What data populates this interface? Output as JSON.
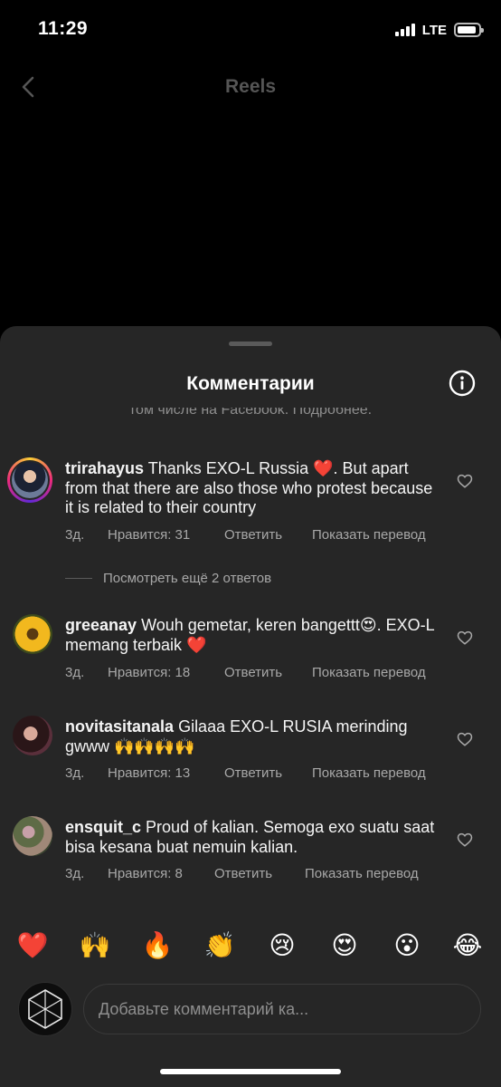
{
  "status_bar": {
    "time": "11:29",
    "network": "LTE"
  },
  "nav": {
    "title": "Reels"
  },
  "sheet": {
    "title": "Комментарии",
    "clipped_notice": "том числе на Facebook. Подробнее."
  },
  "comments": [
    {
      "username": "trirahayus",
      "text": "Thanks EXO-L Russia ❤️. But apart from that there are also those who protest because it is related to their country",
      "time": "3д.",
      "likes": "Нравится: 31",
      "reply": "Ответить",
      "translate": "Показать перевод"
    },
    {
      "username": "greeanay",
      "text": "Wouh gemetar, keren bangettt😍. EXO-L memang terbaik ❤️",
      "time": "3д.",
      "likes": "Нравится: 18",
      "reply": "Ответить",
      "translate": "Показать перевод"
    },
    {
      "username": "novitasitanala",
      "text": "Gilaaa EXO-L RUSIA merinding gwww 🙌🙌🙌🙌",
      "time": "3д.",
      "likes": "Нравится: 13",
      "reply": "Ответить",
      "translate": "Показать перевод"
    },
    {
      "username": "ensquit_c",
      "text": "Proud of kalian. Semoga exo suatu saat bisa kesana buat nemuin kalian.",
      "time": "3д.",
      "likes": "Нравится: 8",
      "reply": "Ответить",
      "translate": "Показать перевод"
    }
  ],
  "more_replies": "Посмотреть ещё 2 ответов",
  "emoji_bar": [
    "❤️",
    "🙌",
    "🔥",
    "👏",
    "😢",
    "😍",
    "😮",
    "😂"
  ],
  "input": {
    "placeholder": "Добавьте комментарий ка..."
  },
  "icons": {
    "back": "chevron-left-icon",
    "info": "info-icon",
    "like": "heart-outline-icon",
    "user_avatar": "exo-logo-avatar"
  },
  "colors": {
    "sheet_background": "#262626",
    "secondary_text": "#a8a8a8"
  }
}
